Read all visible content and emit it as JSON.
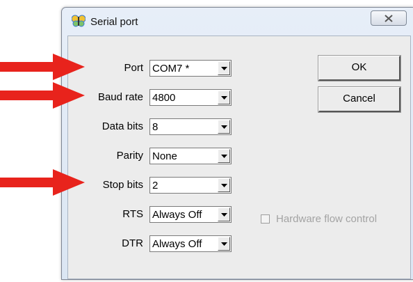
{
  "window": {
    "title": "Serial port"
  },
  "fields": [
    {
      "key": "port",
      "label": "Port",
      "value": "COM7 *"
    },
    {
      "key": "baud_rate",
      "label": "Baud rate",
      "value": "4800"
    },
    {
      "key": "data_bits",
      "label": "Data bits",
      "value": "8"
    },
    {
      "key": "parity",
      "label": "Parity",
      "value": "None"
    },
    {
      "key": "stop_bits",
      "label": "Stop bits",
      "value": "2"
    },
    {
      "key": "rts",
      "label": "RTS",
      "value": "Always Off"
    },
    {
      "key": "dtr",
      "label": "DTR",
      "value": "Always Off"
    }
  ],
  "buttons": {
    "ok": "OK",
    "cancel": "Cancel"
  },
  "hardware_flow_control": {
    "label": "Hardware flow control",
    "checked": false,
    "enabled": false
  },
  "icons": {
    "app": "butterfly-icon",
    "close": "close-icon",
    "dropdown": "chevron-down-icon",
    "annotation": "red-arrow-icon"
  },
  "colors": {
    "annotation_arrow": "#e8231c",
    "disabled_text": "#a3a3a3"
  }
}
